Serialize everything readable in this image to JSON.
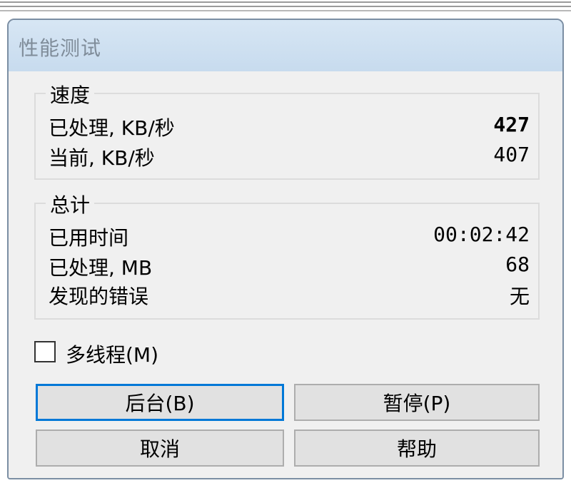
{
  "dialog": {
    "title": "性能测试"
  },
  "speed_group": {
    "legend": "速度",
    "rows": [
      {
        "label": "已处理, KB/秒",
        "value": "427"
      },
      {
        "label": "当前, KB/秒",
        "value": "407"
      }
    ]
  },
  "total_group": {
    "legend": "总计",
    "rows": [
      {
        "label": "已用时间",
        "value": "00:02:42"
      },
      {
        "label": "已处理, MB",
        "value": "68"
      },
      {
        "label": "发现的错误",
        "value": "无"
      }
    ]
  },
  "multithread": {
    "label": "多线程(M)",
    "checked": false
  },
  "buttons": {
    "background": "后台(B)",
    "pause": "暂停(P)",
    "cancel": "取消",
    "help": "帮助"
  },
  "colors": {
    "title_bar": "#c7dbee",
    "window_bg": "#f0f0f0",
    "focus_border": "#0078d7"
  }
}
